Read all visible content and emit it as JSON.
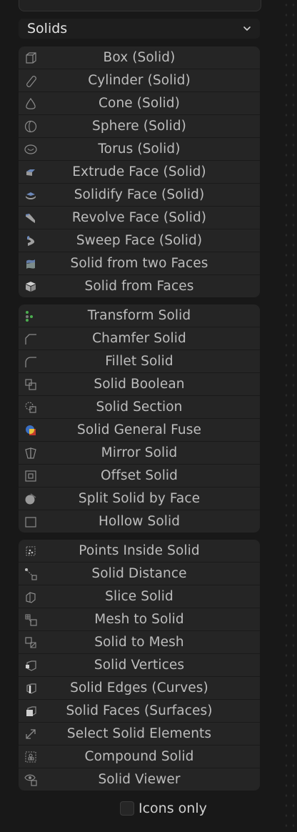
{
  "category": {
    "selected": "Solids"
  },
  "groups": [
    {
      "items": [
        {
          "label": "Box (Solid)",
          "icon": "box-icon"
        },
        {
          "label": "Cylinder (Solid)",
          "icon": "cylinder-icon"
        },
        {
          "label": "Cone (Solid)",
          "icon": "cone-icon"
        },
        {
          "label": "Sphere (Solid)",
          "icon": "sphere-icon"
        },
        {
          "label": "Torus (Solid)",
          "icon": "torus-icon"
        },
        {
          "label": "Extrude Face (Solid)",
          "icon": "extrude-face-icon"
        },
        {
          "label": "Solidify Face (Solid)",
          "icon": "solidify-face-icon"
        },
        {
          "label": "Revolve Face (Solid)",
          "icon": "revolve-face-icon"
        },
        {
          "label": "Sweep Face (Solid)",
          "icon": "sweep-face-icon"
        },
        {
          "label": "Solid from two Faces",
          "icon": "two-faces-icon"
        },
        {
          "label": "Solid from Faces",
          "icon": "cube-faces-icon"
        }
      ]
    },
    {
      "items": [
        {
          "label": "Transform Solid",
          "icon": "transform-icon"
        },
        {
          "label": "Chamfer Solid",
          "icon": "chamfer-icon"
        },
        {
          "label": "Fillet Solid",
          "icon": "fillet-icon"
        },
        {
          "label": "Solid Boolean",
          "icon": "boolean-icon"
        },
        {
          "label": "Solid Section",
          "icon": "section-icon"
        },
        {
          "label": "Solid General Fuse",
          "icon": "general-fuse-icon"
        },
        {
          "label": "Mirror Solid",
          "icon": "mirror-icon"
        },
        {
          "label": "Offset Solid",
          "icon": "offset-icon"
        },
        {
          "label": "Split Solid by Face",
          "icon": "split-icon"
        },
        {
          "label": "Hollow Solid",
          "icon": "hollow-icon"
        }
      ]
    },
    {
      "items": [
        {
          "label": "Points Inside Solid",
          "icon": "points-inside-icon"
        },
        {
          "label": "Solid Distance",
          "icon": "distance-icon"
        },
        {
          "label": "Slice Solid",
          "icon": "slice-icon"
        },
        {
          "label": "Mesh to Solid",
          "icon": "mesh-to-solid-icon"
        },
        {
          "label": "Solid to Mesh",
          "icon": "solid-to-mesh-icon"
        },
        {
          "label": "Solid Vertices",
          "icon": "vertices-icon"
        },
        {
          "label": "Solid Edges (Curves)",
          "icon": "edges-icon"
        },
        {
          "label": "Solid Faces (Surfaces)",
          "icon": "faces-icon"
        },
        {
          "label": "Select Solid Elements",
          "icon": "select-elements-icon"
        },
        {
          "label": "Compound Solid",
          "icon": "compound-icon"
        },
        {
          "label": "Solid Viewer",
          "icon": "viewer-icon"
        }
      ]
    }
  ],
  "footer": {
    "icons_only_label": "Icons only",
    "icons_only_checked": false
  },
  "colors": {
    "background": "#181818",
    "panel": "#252525",
    "text": "#bdbdbd",
    "accent_red": "#c0392b",
    "accent_blue": "#3a6fc4",
    "accent_green": "#4caf50"
  }
}
